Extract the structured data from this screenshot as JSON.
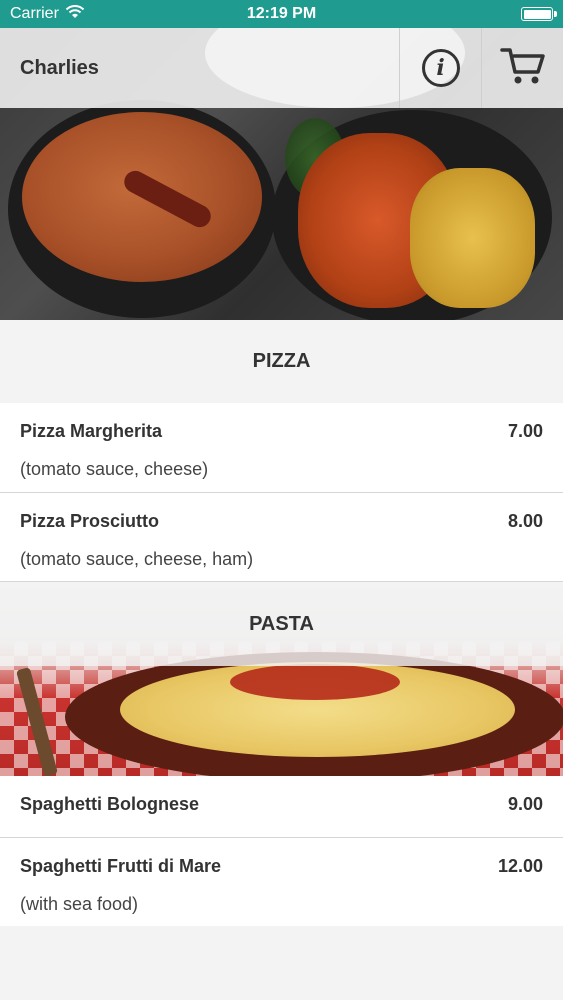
{
  "status_bar": {
    "carrier": "Carrier",
    "time": "12:19 PM"
  },
  "header": {
    "title": "Charlies",
    "info_icon": "info-icon",
    "cart_icon": "cart-icon"
  },
  "sections": [
    {
      "title": "PIZZA",
      "items": [
        {
          "name": "Pizza Margherita",
          "price": "7.00",
          "description": "(tomato sauce, cheese)"
        },
        {
          "name": "Pizza Prosciutto",
          "price": "8.00",
          "description": "(tomato sauce, cheese, ham)"
        }
      ]
    },
    {
      "title": "PASTA",
      "items": [
        {
          "name": "Spaghetti Bolognese",
          "price": "9.00"
        },
        {
          "name": "Spaghetti Frutti di Mare",
          "price": "12.00",
          "description": "(with sea food)"
        }
      ]
    }
  ],
  "colors": {
    "status_bar": "#1f9c8f",
    "text": "#333333"
  }
}
